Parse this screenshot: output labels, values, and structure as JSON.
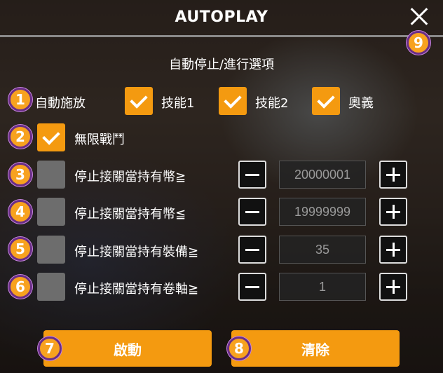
{
  "header": {
    "title": "AUTOPLAY",
    "close_icon": "close-icon"
  },
  "subtitle": "自動停止/進行選項",
  "auto_skill": {
    "label": "自動施放",
    "options": [
      {
        "label": "技能1",
        "checked": true
      },
      {
        "label": "技能2",
        "checked": true
      },
      {
        "label": "奧義",
        "checked": true
      }
    ]
  },
  "infinite_battle": {
    "label": "無限戰鬥",
    "checked": true
  },
  "stop_rows": [
    {
      "label": "停止接關當持有幣≧",
      "value": "20000001",
      "checked": false
    },
    {
      "label": "停止接關當持有幣≦",
      "value": "19999999",
      "checked": false
    },
    {
      "label": "停止接關當持有裝備≧",
      "value": "35",
      "checked": false
    },
    {
      "label": "停止接關當持有卷軸≧",
      "value": "1",
      "checked": false
    }
  ],
  "actions": {
    "start_label": "啟動",
    "clear_label": "清除"
  },
  "badges": [
    "1",
    "2",
    "3",
    "4",
    "5",
    "6",
    "7",
    "8",
    "9"
  ],
  "colors": {
    "accent": "#f49a10",
    "badge_border": "#6a2e86"
  }
}
